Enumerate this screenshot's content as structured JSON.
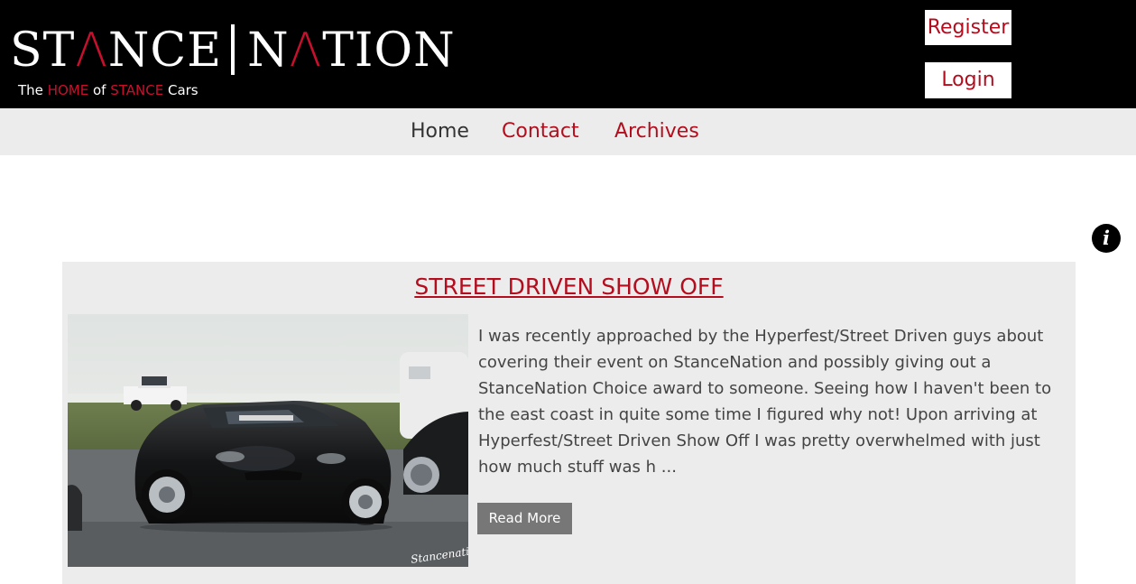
{
  "header": {
    "logo": {
      "part1_a": "ST",
      "part1_b": "Λ",
      "part1_c": "NCE",
      "part2_a": "N",
      "part2_b": "Λ",
      "part2_c": "TION"
    },
    "tagline": {
      "w1": "The",
      "w2": "HOME",
      "w3": "of",
      "w4": "STANCE",
      "w5": "Cars"
    },
    "register_label": "Register",
    "login_label": "Login"
  },
  "nav": {
    "items": [
      {
        "label": "Home"
      },
      {
        "label": "Contact"
      },
      {
        "label": "Archives"
      }
    ]
  },
  "info_icon": {
    "glyph": "i"
  },
  "article": {
    "title": "STREET DRIVEN SHOW OFF",
    "excerpt": "I was recently approached by the Hyperfest/Street Driven guys about covering their event on StanceNation and possibly giving out a StanceNation Choice award to someone. Seeing how I haven't been to the east coast in quite some time I figured why not! Upon arriving at Hyperfest/Street Driven Show Off I was pretty overwhelmed with just how much stuff was h ...",
    "read_more_label": "Read More",
    "image_watermark": "Stancenation"
  },
  "colors": {
    "brand_red": "#b30d1e",
    "header_bg": "#000000",
    "nav_bg": "#ececec",
    "card_bg": "#ececec",
    "button_gray": "#777777"
  }
}
